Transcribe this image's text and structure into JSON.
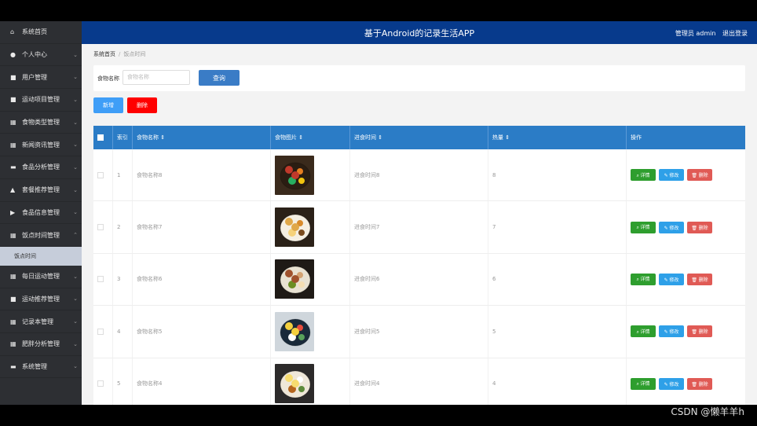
{
  "app": {
    "title": "基于Android的记录生活APP",
    "user_label": "管理员 admin",
    "logout": "退出登录"
  },
  "sidebar": {
    "items": [
      {
        "label": "系统首页",
        "icon": "home-icon",
        "glyph": "⌂",
        "chev": ""
      },
      {
        "label": "个人中心",
        "icon": "user-icon",
        "glyph": "●",
        "chev": "⌄"
      },
      {
        "label": "用户管理",
        "icon": "users-icon",
        "glyph": "■",
        "chev": "⌄"
      },
      {
        "label": "运动项目管理",
        "icon": "clipboard-icon",
        "glyph": "■",
        "chev": "⌄"
      },
      {
        "label": "食物类型管理",
        "icon": "grid-icon",
        "glyph": "▦",
        "chev": "⌄"
      },
      {
        "label": "新闻资讯管理",
        "icon": "grid-icon",
        "glyph": "▦",
        "chev": "⌄"
      },
      {
        "label": "食品分析管理",
        "icon": "monitor-icon",
        "glyph": "▬",
        "chev": "⌄"
      },
      {
        "label": "套餐推荐管理",
        "icon": "thumb-icon",
        "glyph": "▲",
        "chev": "⌄"
      },
      {
        "label": "食品信息管理",
        "icon": "flag-icon",
        "glyph": "▶",
        "chev": "⌄"
      },
      {
        "label": "饭点时间管理",
        "icon": "grid-icon",
        "glyph": "▦",
        "chev": "⌃"
      }
    ],
    "sub_item": "饭点时间",
    "items_after": [
      {
        "label": "每日运动管理",
        "icon": "table-icon",
        "glyph": "▦",
        "chev": "⌄"
      },
      {
        "label": "运动推荐管理",
        "icon": "clipboard-icon",
        "glyph": "■",
        "chev": "⌄"
      },
      {
        "label": "记录本管理",
        "icon": "grid-icon",
        "glyph": "▦",
        "chev": "⌄"
      },
      {
        "label": "肥胖分析管理",
        "icon": "grid-icon",
        "glyph": "▦",
        "chev": "⌄"
      },
      {
        "label": "系统管理",
        "icon": "monitor-icon",
        "glyph": "▬",
        "chev": "⌄"
      }
    ]
  },
  "breadcrumb": {
    "home": "系统首页",
    "sep": "/",
    "current": "饭点时间"
  },
  "search": {
    "label": "食物名称",
    "placeholder": "食物名称",
    "button": "查询"
  },
  "actions": {
    "add": "新增",
    "delete": "删除"
  },
  "table": {
    "headers": [
      "索引",
      "食物名称 ⇕",
      "食物图片 ⇕",
      "进食时间 ⇕",
      "热量 ⇕",
      "操作"
    ],
    "rows": [
      {
        "index": "1",
        "name": "食物名称8",
        "time": "进食时间8",
        "calories": "8",
        "img_theme": "a"
      },
      {
        "index": "2",
        "name": "食物名称7",
        "time": "进食时间7",
        "calories": "7",
        "img_theme": "b"
      },
      {
        "index": "3",
        "name": "食物名称6",
        "time": "进食时间6",
        "calories": "6",
        "img_theme": "c"
      },
      {
        "index": "4",
        "name": "食物名称5",
        "time": "进食时间5",
        "calories": "5",
        "img_theme": "d"
      },
      {
        "index": "5",
        "name": "食物名称4",
        "time": "进食时间4",
        "calories": "4",
        "img_theme": "e"
      }
    ],
    "row_actions": {
      "detail": "⌕ 详情",
      "edit": "✎ 修改",
      "delete": "🗑 删除"
    }
  },
  "watermark": "CSDN @懒羊羊h",
  "colors": {
    "topbar": "#073a8c",
    "sidebar": "#2d2f33",
    "table_header": "#2b7cc6",
    "add": "#3f9ef7",
    "delete": "#ff0000"
  }
}
